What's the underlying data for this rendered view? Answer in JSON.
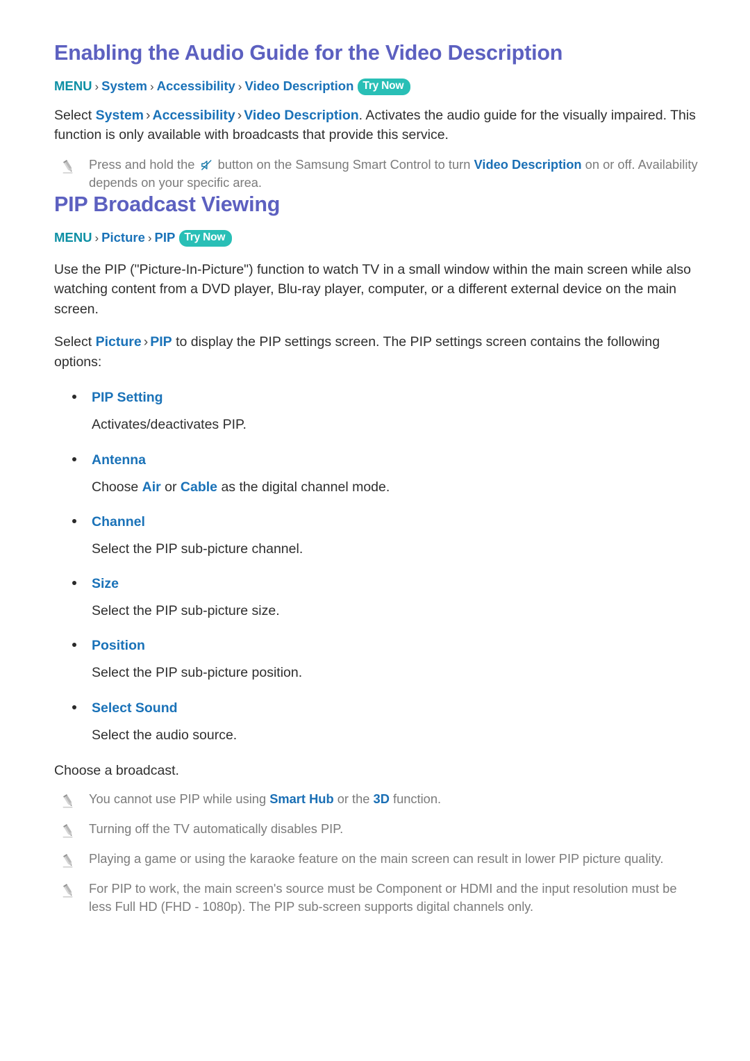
{
  "document": {
    "sections": [
      {
        "id": "video-description",
        "heading": "Enabling the Audio Guide for the Video Description",
        "breadcrumb": {
          "menu": "MENU",
          "items": [
            "System",
            "Accessibility",
            "Video Description"
          ],
          "separator": "›",
          "badge": "Try Now"
        },
        "paragraph": {
          "lead": "Select ",
          "link1": "System",
          "link2": "Accessibility",
          "link3": "Video Description",
          "tail": ". Activates the audio guide for the visually impaired. This function is only available with broadcasts that provide this service."
        },
        "note": {
          "part1": "Press and hold the ",
          "icon": "mute-icon",
          "part2": " button on the Samsung Smart Control to turn ",
          "link": "Video Description",
          "part3": " on or off. Availability depends on your specific area."
        }
      }
    ],
    "pip": {
      "heading": "PIP Broadcast Viewing",
      "breadcrumb": {
        "menu": "MENU",
        "items": [
          "Picture",
          "PIP"
        ],
        "separator": "›",
        "badge": "Try Now"
      },
      "intro": "Use the PIP (\"Picture-In-Picture\") function to watch TV in a small window within the main screen while also watching content from a DVD player, Blu-ray player, computer, or a different external device on the main screen.",
      "select_line": {
        "lead": "Select ",
        "link1": "Picture",
        "link2": "PIP",
        "tail": " to display the PIP settings screen. The PIP settings screen contains the following options:"
      },
      "options": [
        {
          "title": "PIP Setting",
          "desc": "Activates/deactivates PIP."
        },
        {
          "title": "Antenna",
          "desc_lead": "Choose ",
          "desc_link1": "Air",
          "desc_mid": " or ",
          "desc_link2": "Cable",
          "desc_tail": " as the digital channel mode."
        },
        {
          "title": "Channel",
          "desc": "Select the PIP sub-picture channel."
        },
        {
          "title": "Size",
          "desc": "Select the PIP sub-picture size."
        },
        {
          "title": "Position",
          "desc": "Select the PIP sub-picture position."
        },
        {
          "title": "Select Sound",
          "desc": "Select the audio source."
        }
      ],
      "closing_line": "Choose a broadcast.",
      "notes": [
        {
          "part1": "You cannot use PIP while using ",
          "link1": "Smart Hub",
          "part2": " or the ",
          "link2": "3D",
          "part3": " function."
        },
        {
          "text": "Turning off the TV automatically disables PIP."
        },
        {
          "text": "Playing a game or using the karaoke feature on the main screen can result in lower PIP picture quality."
        },
        {
          "text": "For PIP to work, the main screen's source must be Component or HDMI and the input resolution must be less Full HD (FHD - 1080p). The PIP sub-screen supports digital channels only."
        }
      ]
    },
    "colors": {
      "heading": "#5c60c0",
      "menu_teal": "#0c8fa4",
      "link_blue": "#1a72b8",
      "badge_teal": "#29bfb6",
      "note_gray": "#7b7b7b",
      "body": "#2e2e2e"
    }
  }
}
